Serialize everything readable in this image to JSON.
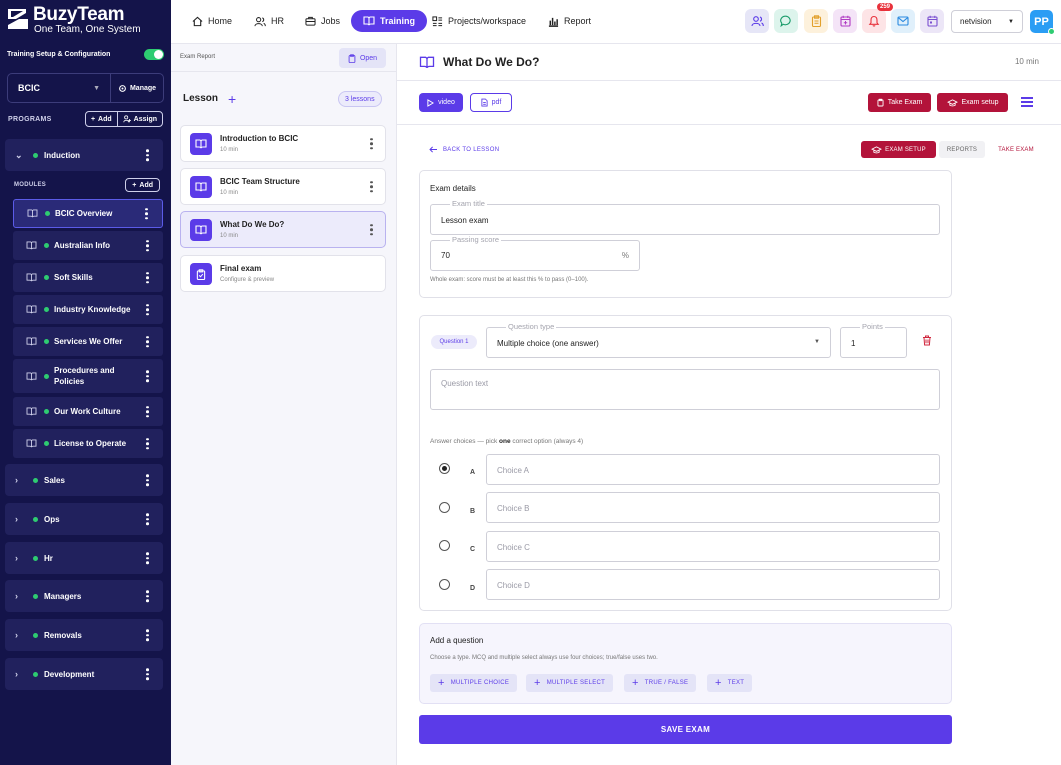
{
  "brand": {
    "name": "BuzyTeam",
    "tagline": "One Team, One System"
  },
  "sidebar": {
    "section_title": "Training Setup & Configuration",
    "org_select": "BCIC",
    "manage_label": "Manage",
    "programs_label": "PROGRAMS",
    "add_label": "Add",
    "assign_label": "Assign",
    "modules_label": "MODULES",
    "module_add_label": "Add",
    "expanded_program": "Induction",
    "modules": [
      "BCIC Overview",
      "Australian Info",
      "Soft Skills",
      "Industry Knowledge",
      "Services We Offer",
      "Procedures and Policies",
      "Our Work Culture",
      "License to Operate"
    ],
    "programs": [
      "Sales",
      "Ops",
      "Hr",
      "Managers",
      "Removals",
      "Development"
    ]
  },
  "topnav": {
    "items": [
      "Home",
      "HR",
      "Jobs",
      "Training",
      "Projects/workspace",
      "Report"
    ],
    "active": "Training",
    "notification_count": "259",
    "workspace": "netvision",
    "avatar_initials": "PP"
  },
  "lessons_panel": {
    "exam_report_label": "Exam Report",
    "open_label": "Open",
    "title": "Lesson",
    "count_label": "3 lessons",
    "lessons": [
      {
        "title": "Introduction to BCIC",
        "sub": "10 min"
      },
      {
        "title": "BCIC Team Structure",
        "sub": "10 min"
      },
      {
        "title": "What Do We Do?",
        "sub": "10 min"
      },
      {
        "title": "Final exam",
        "sub": "Configure & preview"
      }
    ]
  },
  "main": {
    "title": "What Do We Do?",
    "duration": "10 min",
    "video_label": "video",
    "pdf_label": "pdf",
    "take_exam_label": "Take Exam",
    "exam_setup_label": "Exam setup",
    "back_label": "BACK TO LESSON",
    "tabs": {
      "setup": "EXAM SETUP",
      "reports": "REPORTS",
      "take": "TAKE EXAM"
    },
    "exam_details": {
      "heading": "Exam details",
      "title_label": "Exam title",
      "title_value": "Lesson exam",
      "passing_label": "Passing score",
      "passing_value": "70",
      "percent_symbol": "%",
      "hint": "Whole exam: score must be at least this % to pass (0–100)."
    },
    "question": {
      "chip": "Question 1",
      "type_label": "Question type",
      "type_value": "Multiple choice (one answer)",
      "points_label": "Points",
      "points_value": "1",
      "text_placeholder": "Question text",
      "answer_hint_a": "Answer choices",
      "answer_hint_b": " — pick ",
      "answer_hint_c": "one",
      "answer_hint_d": " correct option (always 4)",
      "choices": [
        {
          "letter": "A",
          "placeholder": "Choice A"
        },
        {
          "letter": "B",
          "placeholder": "Choice B"
        },
        {
          "letter": "C",
          "placeholder": "Choice C"
        },
        {
          "letter": "D",
          "placeholder": "Choice D"
        }
      ]
    },
    "add_question": {
      "heading": "Add a question",
      "hint": "Choose a type. MCQ and multiple select always use four choices; true/false uses two.",
      "buttons": [
        "MULTIPLE CHOICE",
        "MULTIPLE SELECT",
        "TRUE / FALSE",
        "TEXT"
      ]
    },
    "save_label": "SAVE EXAM"
  }
}
